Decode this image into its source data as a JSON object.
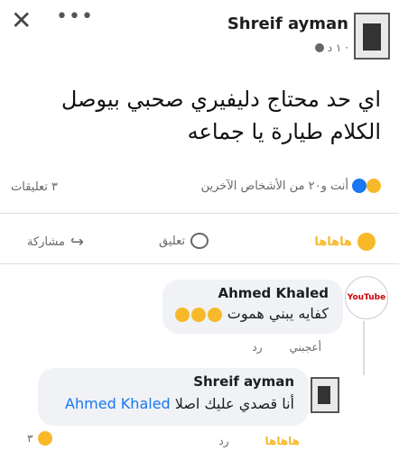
{
  "post": {
    "author": "Shreif ayman",
    "time": "١ د ·",
    "text_line1": "اي حد محتاج دليفيري صحبي بيوصل",
    "text_line2": "الكلام طيارة يا جماعه",
    "reactions_summary": "أنت و٢٠ من الأشخاص الآخرين",
    "comment_count": "٣ تعليقات"
  },
  "actions": {
    "haha": "هاهاها",
    "comment": "تعليق",
    "share": "مشاركة"
  },
  "comment1": {
    "author": "Ahmed Khaled",
    "avatar_label": "YouTube",
    "text": "كفايه يبني هموت",
    "like": "أعجبني",
    "reply": "رد"
  },
  "reply1": {
    "author": "Shreif ayman",
    "text": "أنا قصدي عليك اصلا",
    "mention": "Ahmed Khaled",
    "haha": "هاهاها",
    "reply": "رد",
    "reaction_count": "٣"
  },
  "header": {
    "close_glyph": "✕",
    "more_glyph": "•••"
  },
  "colors": {
    "link": "#1877f2",
    "haha": "#f7b928",
    "muted": "#65676b"
  }
}
